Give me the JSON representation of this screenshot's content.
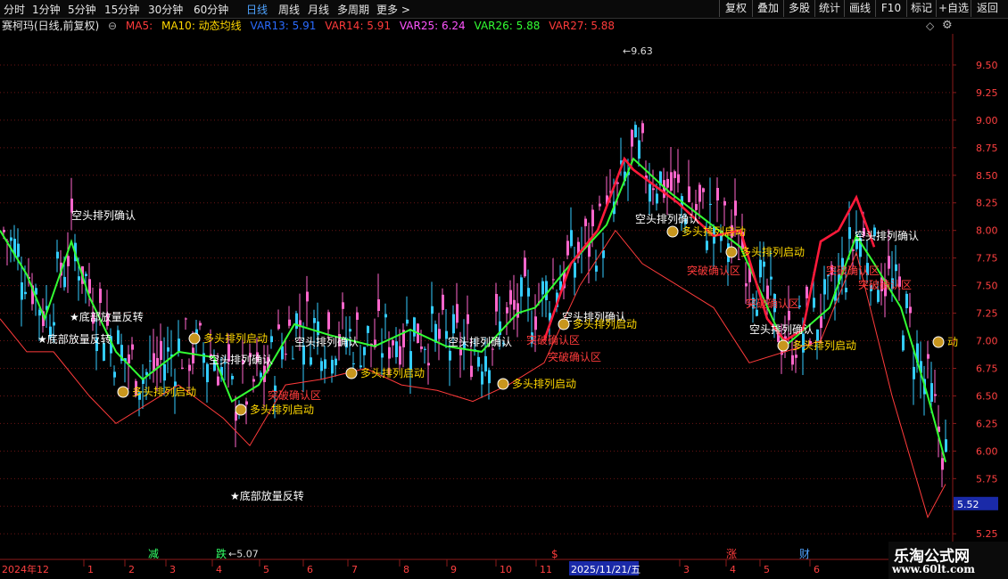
{
  "toolbar": {
    "periods": [
      "分时",
      "1分钟",
      "5分钟",
      "15分钟",
      "30分钟",
      "60分钟",
      "日线",
      "周线",
      "月线",
      "多周期",
      "更多 >"
    ],
    "active_period": "日线",
    "right_tools": [
      "复权",
      "叠加",
      "多股",
      "统计",
      "画线",
      "F10",
      "标记",
      "+自选",
      "返回"
    ]
  },
  "legend": {
    "title": "赛柯玛(日线,前复权)",
    "items": [
      {
        "text": "MA5:",
        "color": "#ff3b3b"
      },
      {
        "text": "MA10: 动态均线",
        "color": "#ffd700"
      },
      {
        "text": "VAR13: 5.91",
        "color": "#2a6bff"
      },
      {
        "text": "VAR14: 5.91",
        "color": "#ff3b3b"
      },
      {
        "text": "VAR25: 6.24",
        "color": "#ff55ff"
      },
      {
        "text": "VAR26: 5.88",
        "color": "#33ff33"
      },
      {
        "text": "VAR27: 5.88",
        "color": "#ff3b3b"
      }
    ]
  },
  "chart_data": {
    "type": "line",
    "title": "赛柯玛(日线,前复权)",
    "ylim": [
      5.05,
      9.75
    ],
    "y_ticks": [
      "9.50",
      "9.25",
      "9.00",
      "8.75",
      "8.50",
      "8.25",
      "8.00",
      "7.75",
      "7.50",
      "7.25",
      "7.00",
      "6.75",
      "6.50",
      "6.25",
      "6.00",
      "5.75",
      "5.50",
      "5.25"
    ],
    "current_price": "5.52",
    "high_label": "9.63",
    "low_label": "5.07",
    "x_labels": [
      "2024年12",
      "1",
      "2",
      "3",
      "4",
      "5",
      "6",
      "7",
      "8",
      "9",
      "10",
      "11",
      "2025/11/21/五",
      "3",
      "4",
      "5",
      "6"
    ],
    "top_markers": [
      {
        "text": "减",
        "color": "#33ff66"
      },
      {
        "text": "跌",
        "color": "#33ff66"
      },
      {
        "text": "$",
        "color": "#ff3b3b"
      },
      {
        "text": "涨",
        "color": "#ff3b3b"
      },
      {
        "text": "财",
        "color": "#4fa3ff"
      }
    ],
    "series": [
      {
        "name": "VAR26",
        "color": "#33ff33",
        "x": [
          0,
          30,
          50,
          80,
          100,
          130,
          160,
          200,
          240,
          260,
          290,
          330,
          370,
          420,
          460,
          500,
          540,
          580,
          600,
          640,
          680,
          710,
          750,
          790,
          830,
          880,
          930,
          960,
          980,
          1010,
          1040,
          1060
        ],
        "y": [
          8.0,
          7.6,
          7.2,
          7.9,
          7.4,
          6.9,
          6.65,
          6.9,
          6.85,
          6.45,
          6.6,
          7.15,
          7.05,
          6.95,
          7.1,
          6.95,
          6.9,
          7.25,
          7.3,
          7.7,
          8.05,
          8.65,
          8.35,
          8.1,
          7.85,
          6.95,
          7.3,
          7.95,
          7.7,
          7.3,
          6.5,
          5.9
        ]
      },
      {
        "name": "MA5",
        "color": "#ff1a3a",
        "x": [
          610,
          640,
          670,
          700,
          710,
          760,
          800,
          830,
          860,
          880,
          900,
          920,
          940,
          960,
          980
        ],
        "y": [
          7.0,
          7.7,
          8.0,
          8.65,
          8.55,
          8.25,
          7.95,
          8.0,
          7.2,
          7.0,
          7.1,
          7.9,
          8.0,
          8.3,
          7.85
        ]
      },
      {
        "name": "VAR27",
        "color": "#ff3b3b",
        "x": [
          0,
          30,
          60,
          100,
          130,
          160,
          200,
          250,
          280,
          320,
          360,
          410,
          450,
          490,
          530,
          570,
          610,
          650,
          690,
          720,
          760,
          800,
          840,
          880,
          920,
          960,
          1000,
          1040,
          1060
        ],
        "y": [
          7.2,
          6.9,
          6.9,
          6.5,
          6.25,
          6.4,
          6.6,
          6.3,
          6.05,
          6.6,
          6.65,
          6.75,
          6.6,
          6.55,
          6.45,
          6.6,
          6.8,
          7.5,
          8.0,
          7.7,
          7.5,
          7.3,
          6.8,
          6.9,
          7.0,
          7.8,
          6.5,
          5.4,
          5.7
        ]
      }
    ],
    "annotations": [
      {
        "text": "空头排列确认",
        "color": "#ffffff"
      },
      {
        "text": "底部放量反转",
        "color": "#ffffff"
      },
      {
        "text": "底部放量反转",
        "color": "#ffffff"
      },
      {
        "text": "多头排列启动",
        "color": "#ffd700"
      },
      {
        "text": "空头排列确认",
        "color": "#ffffff"
      },
      {
        "text": "多头排列启动",
        "color": "#ffd700"
      },
      {
        "text": "底部放量反转",
        "color": "#ffffff"
      },
      {
        "text": "突破确认区",
        "color": "#ff3b3b"
      },
      {
        "text": "多头排列启动",
        "color": "#ffd700"
      },
      {
        "text": "多头排列启动",
        "color": "#ffd700"
      },
      {
        "text": "空头排列确认",
        "color": "#ffffff"
      },
      {
        "text": "多头排列启动",
        "color": "#ffd700"
      },
      {
        "text": "突破确认区",
        "color": "#ff3b3b"
      },
      {
        "text": "空头排列确认",
        "color": "#ffffff"
      },
      {
        "text": "多头排列启动",
        "color": "#ffd700"
      },
      {
        "text": "突破确认区",
        "color": "#ff3b3b"
      },
      {
        "text": "空头排列确认",
        "color": "#ffffff"
      },
      {
        "text": "多头排列启动",
        "color": "#ffd700"
      },
      {
        "text": "突破确认区",
        "color": "#ff3b3b"
      },
      {
        "text": "空头排列确认",
        "color": "#ffffff"
      },
      {
        "text": "多头排列启动",
        "color": "#ffd700"
      },
      {
        "text": "突破确认区",
        "color": "#ff3b3b"
      },
      {
        "text": "空头排列确认",
        "color": "#ffffff"
      },
      {
        "text": "多头排列启动",
        "color": "#ffd700"
      },
      {
        "text": "空头排列确认",
        "color": "#ffffff"
      },
      {
        "text": "突破确认区",
        "color": "#ff3b3b"
      },
      {
        "text": "突破确认区",
        "color": "#ff3b3b"
      },
      {
        "text": "动",
        "color": "#ffd700"
      }
    ]
  },
  "watermark": {
    "line1": "乐淘公式网",
    "line2": "www.60lt.com"
  }
}
